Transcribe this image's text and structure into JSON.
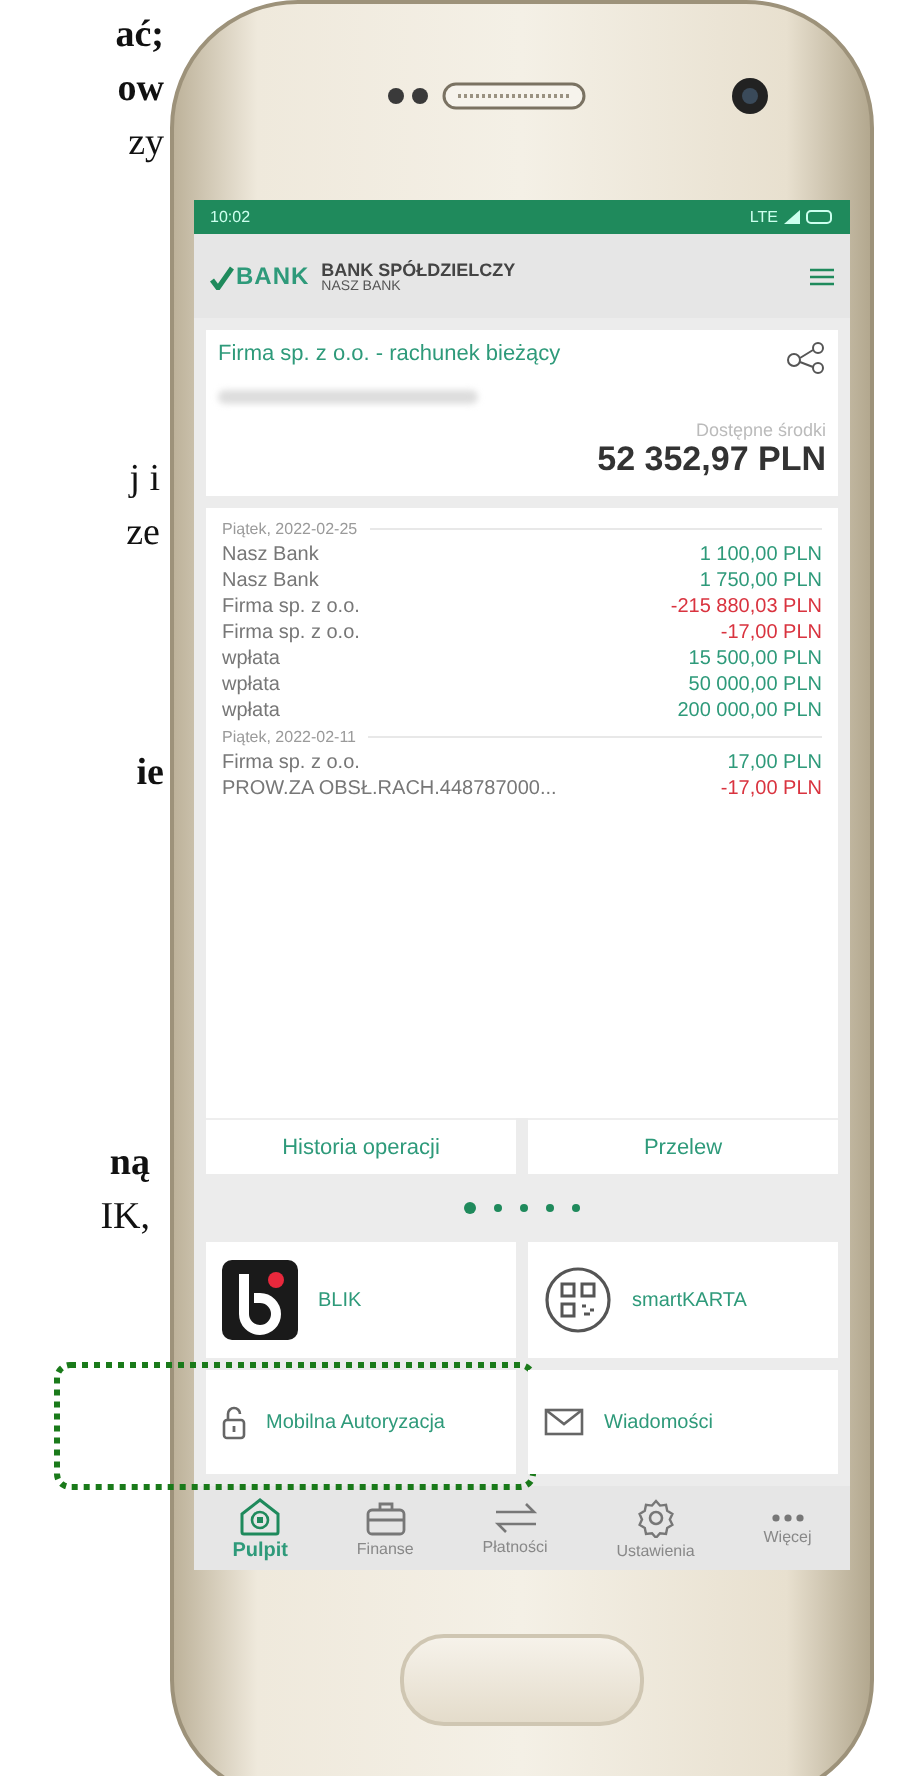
{
  "document_fragments": [
    {
      "lines": [
        {
          "text": "ać;",
          "bold": true
        },
        {
          "text": "ow",
          "bold": true
        },
        {
          "text": "zy",
          "bold": false
        }
      ]
    },
    {
      "lines": [
        {
          "text": "j i",
          "bold": false
        },
        {
          "text": "ze",
          "bold": false
        }
      ]
    },
    {
      "lines": [
        {
          "text": "ie",
          "bold": true
        }
      ]
    },
    {
      "lines": [
        {
          "text": "ną",
          "bold": true
        },
        {
          "text": "IK,",
          "bold": false
        }
      ]
    }
  ],
  "status_bar": {
    "time": "10:02",
    "network": "LTE"
  },
  "header": {
    "logo_text": "BANK",
    "bank_name": "BANK SPÓŁDZIELCZY",
    "bank_subtitle": "NASZ BANK"
  },
  "account": {
    "name": "Firma sp. z o.o. - rachunek bieżący",
    "balance_label": "Dostępne środki",
    "balance": "52 352,97 PLN"
  },
  "transaction_groups": [
    {
      "date": "Piątek, 2022-02-25",
      "items": [
        {
          "name": "Nasz Bank",
          "amount": "1 100,00 PLN",
          "kind": "credit"
        },
        {
          "name": "Nasz Bank",
          "amount": "1 750,00 PLN",
          "kind": "credit"
        },
        {
          "name": "Firma sp. z o.o.",
          "amount": "-215 880,03 PLN",
          "kind": "debit"
        },
        {
          "name": "Firma sp. z o.o.",
          "amount": "-17,00 PLN",
          "kind": "debit"
        },
        {
          "name": "wpłata",
          "amount": "15 500,00 PLN",
          "kind": "credit"
        },
        {
          "name": "wpłata",
          "amount": "50 000,00 PLN",
          "kind": "credit"
        },
        {
          "name": "wpłata",
          "amount": "200 000,00 PLN",
          "kind": "credit"
        }
      ]
    },
    {
      "date": "Piątek, 2022-02-11",
      "items": [
        {
          "name": "Firma sp. z o.o.",
          "amount": "17,00 PLN",
          "kind": "credit"
        },
        {
          "name": "PROW.ZA OBSŁ.RACH.448787000...",
          "amount": "-17,00 PLN",
          "kind": "debit"
        }
      ]
    }
  ],
  "actions": [
    "Historia operacji",
    "Przelew"
  ],
  "pager": [
    {
      "selected": true
    },
    {
      "selected": false
    },
    {
      "selected": false
    },
    {
      "selected": false
    },
    {
      "selected": false
    }
  ],
  "tiles": [
    {
      "label": "BLIK",
      "highlighted": false
    },
    {
      "label": "smartKARTA",
      "highlighted": false
    },
    {
      "label": "Mobilna Autoryzacja",
      "highlighted": true
    },
    {
      "label": "Wiadomości",
      "highlighted": false
    }
  ],
  "nav": [
    {
      "label": "Pulpit",
      "selected": true
    },
    {
      "label": "Finanse",
      "selected": false
    },
    {
      "label": "Płatności",
      "selected": false
    },
    {
      "label": "Ustawienia",
      "selected": false
    },
    {
      "label": "Więcej",
      "selected": false
    }
  ]
}
